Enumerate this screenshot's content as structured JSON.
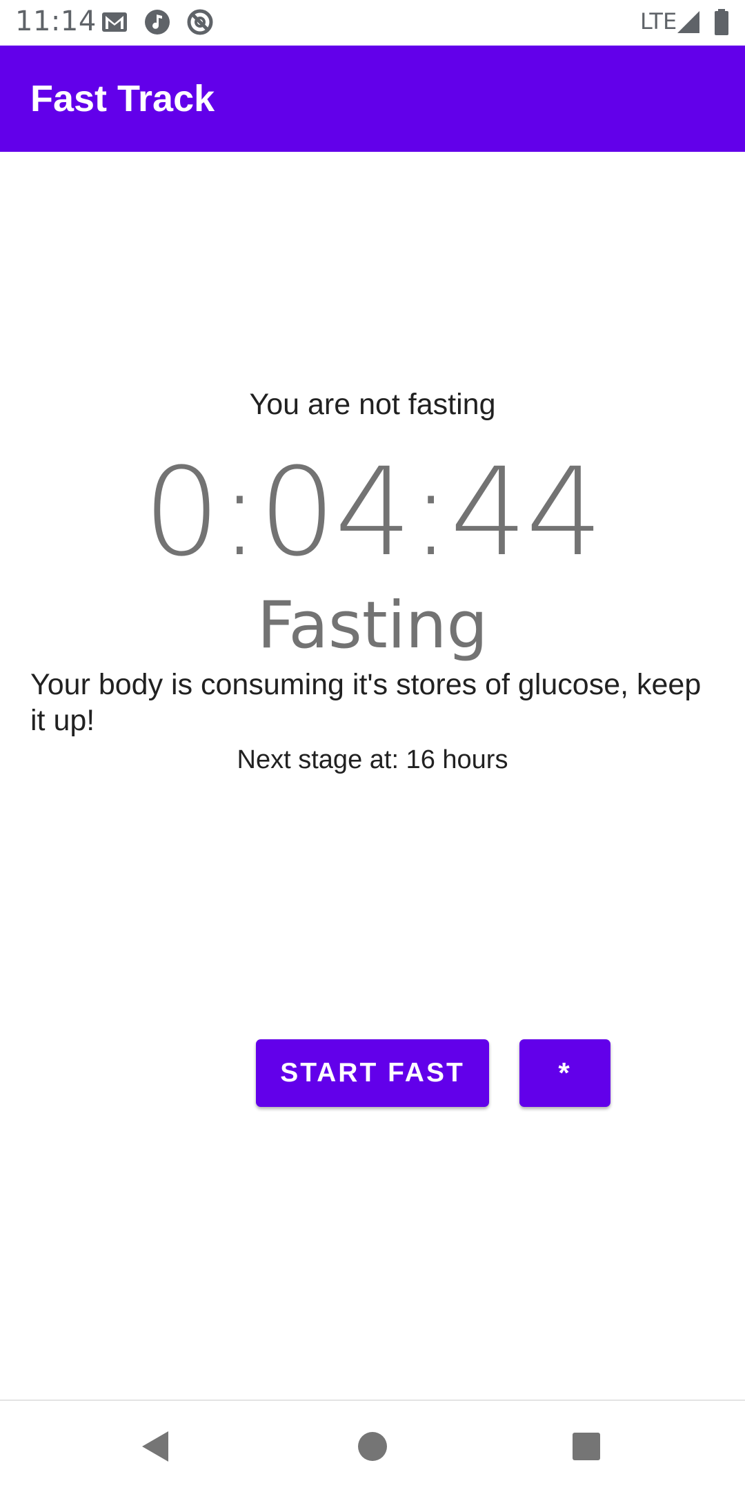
{
  "status_bar": {
    "time": "11:14",
    "network": "LTE",
    "icons": [
      "gmail-icon",
      "music-icon",
      "no-disturb-icon",
      "signal-icon",
      "battery-icon"
    ]
  },
  "app_bar": {
    "title": "Fast Track",
    "color": "#6200ea"
  },
  "main": {
    "status_text": "You are not fasting",
    "timer": "0:04:44",
    "stage_name": "Fasting",
    "description": "Your body is consuming it's stores of glucose, keep it up!",
    "next_stage": "Next stage at: 16 hours"
  },
  "buttons": {
    "start_label": "START FAST",
    "star_label": "*"
  },
  "nav": {
    "icons": [
      "back-icon",
      "home-icon",
      "recents-icon"
    ]
  }
}
